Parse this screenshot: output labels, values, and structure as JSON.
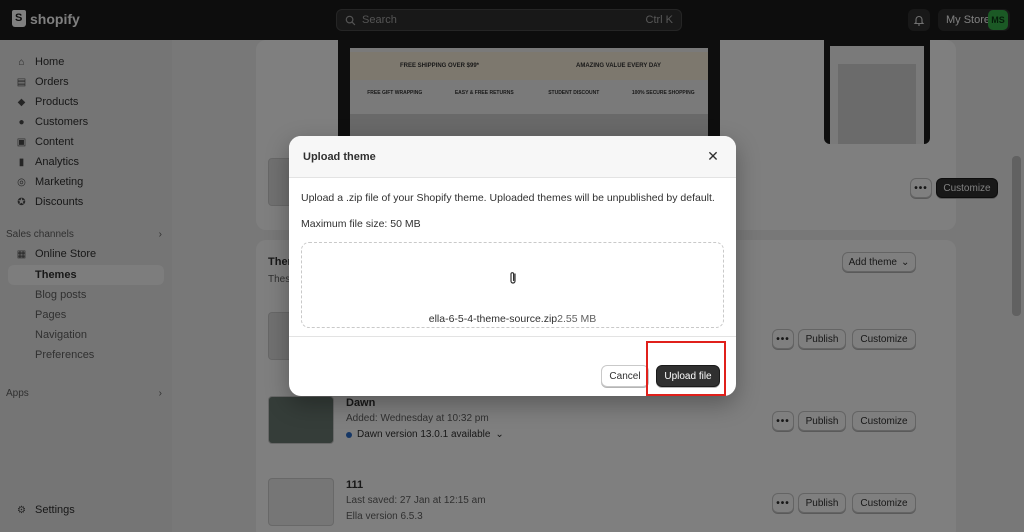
{
  "topbar": {
    "brand": "shopify",
    "search_placeholder": "Search",
    "search_shortcut": "Ctrl K",
    "store_name": "My Store",
    "avatar_initials": "MS"
  },
  "sidebar": {
    "items": [
      {
        "label": "Home",
        "icon": "home-icon"
      },
      {
        "label": "Orders",
        "icon": "orders-icon"
      },
      {
        "label": "Products",
        "icon": "tag-icon"
      },
      {
        "label": "Customers",
        "icon": "person-icon"
      },
      {
        "label": "Content",
        "icon": "content-icon"
      },
      {
        "label": "Analytics",
        "icon": "chart-icon"
      },
      {
        "label": "Marketing",
        "icon": "target-icon"
      },
      {
        "label": "Discounts",
        "icon": "discount-icon"
      }
    ],
    "sales_channels_label": "Sales channels",
    "online_store_label": "Online Store",
    "sub_items": [
      "Themes",
      "Blog posts",
      "Pages",
      "Navigation",
      "Preferences"
    ],
    "apps_label": "Apps",
    "settings_label": "Settings"
  },
  "background": {
    "preview_banner_1": "FREE SHIPPING OVER $99*",
    "preview_banner_2": "AMAZING VALUE EVERY DAY",
    "preview_feat_1": "FREE GIFT WRAPPING",
    "preview_feat_2": "EASY & FREE RETURNS",
    "preview_feat_3": "STUDENT DISCOUNT",
    "preview_feat_4": "100% SECURE SHOPPING",
    "customize_label": "Customize",
    "publish_label": "Publish",
    "library_title_fragment": "Them",
    "library_desc_fragment": "Thes",
    "add_theme_label": "Add theme",
    "theme_dawn": {
      "name": "Dawn",
      "added": "Added: Wednesday at 10:32 pm",
      "version": "Dawn version 13.0.1 available"
    },
    "theme_111": {
      "name": "111",
      "saved": "Last saved: 27 Jan at 12:15 am",
      "version": "Ella version 6.5.3"
    }
  },
  "modal": {
    "title": "Upload theme",
    "description": "Upload a .zip file of your Shopify theme. Uploaded themes will be unpublished by default.",
    "max_size": "Maximum file size: 50 MB",
    "file_name": "ella-6-5-4-theme-source.zip",
    "file_size": "2.55 MB",
    "cancel_label": "Cancel",
    "upload_label": "Upload file"
  },
  "colors": {
    "topbar": "#1a1a1a",
    "primary_button": "#303030",
    "avatar": "#36b34a",
    "highlight": "#e0201b"
  }
}
